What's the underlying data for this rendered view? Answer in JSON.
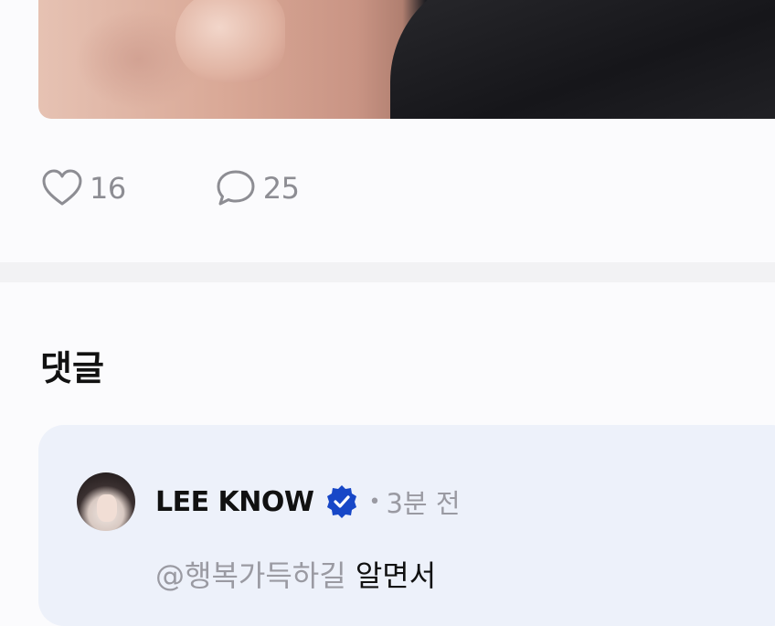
{
  "post": {
    "image_alt": "photo",
    "likes": "16",
    "comments": "25"
  },
  "comments_section": {
    "title": "댓글"
  },
  "comment": {
    "author": "LEE KNOW",
    "verified": true,
    "time": "3분 전",
    "mention": "@행복가득하길",
    "text": "알면서"
  },
  "icons": {
    "like": "heart-outline-icon",
    "comment": "speech-bubble-icon",
    "badge": "verified-badge-icon"
  },
  "colors": {
    "badge": "#1747c7",
    "muted": "#9a9aa2",
    "card": "#edf1fa"
  }
}
